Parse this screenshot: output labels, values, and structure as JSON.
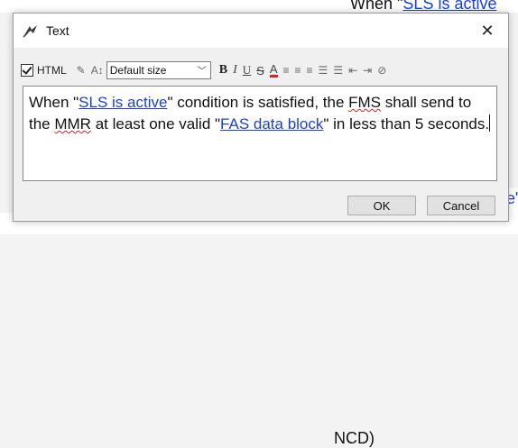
{
  "background": {
    "top_text_prefix": "When \"",
    "top_link": "SLS is active",
    "right_fragment": "e\"",
    "bottom_text": "NCD)"
  },
  "dialog": {
    "title": "Text",
    "close_glyph": "✕",
    "toolbar": {
      "html_label": "HTML",
      "html_checked": true,
      "font_size_value": "Default size",
      "icons": [
        "brush-icon",
        "font-size-icon",
        "bold-icon",
        "italic-icon",
        "underline-icon",
        "strikethrough-icon",
        "text-color-icon",
        "align-left-icon",
        "align-center-icon",
        "align-right-icon",
        "ordered-list-icon",
        "unordered-list-icon",
        "outdent-icon",
        "indent-icon",
        "clear-format-icon"
      ]
    },
    "editor": {
      "t1": "When \"",
      "link1": "SLS is active",
      "t2": "\" condition is satisfied, the ",
      "w_fms": "FMS",
      "t3": " shall send to the ",
      "w_mmr": "MMR",
      "t4": " at least one valid \"",
      "link2": "FAS data block",
      "t5": "\" in less than 5 seconds."
    },
    "ok_label": "OK",
    "cancel_label": "Cancel"
  },
  "colors": {
    "link": "#1a3fd6",
    "spellcheck": "#d22222"
  }
}
